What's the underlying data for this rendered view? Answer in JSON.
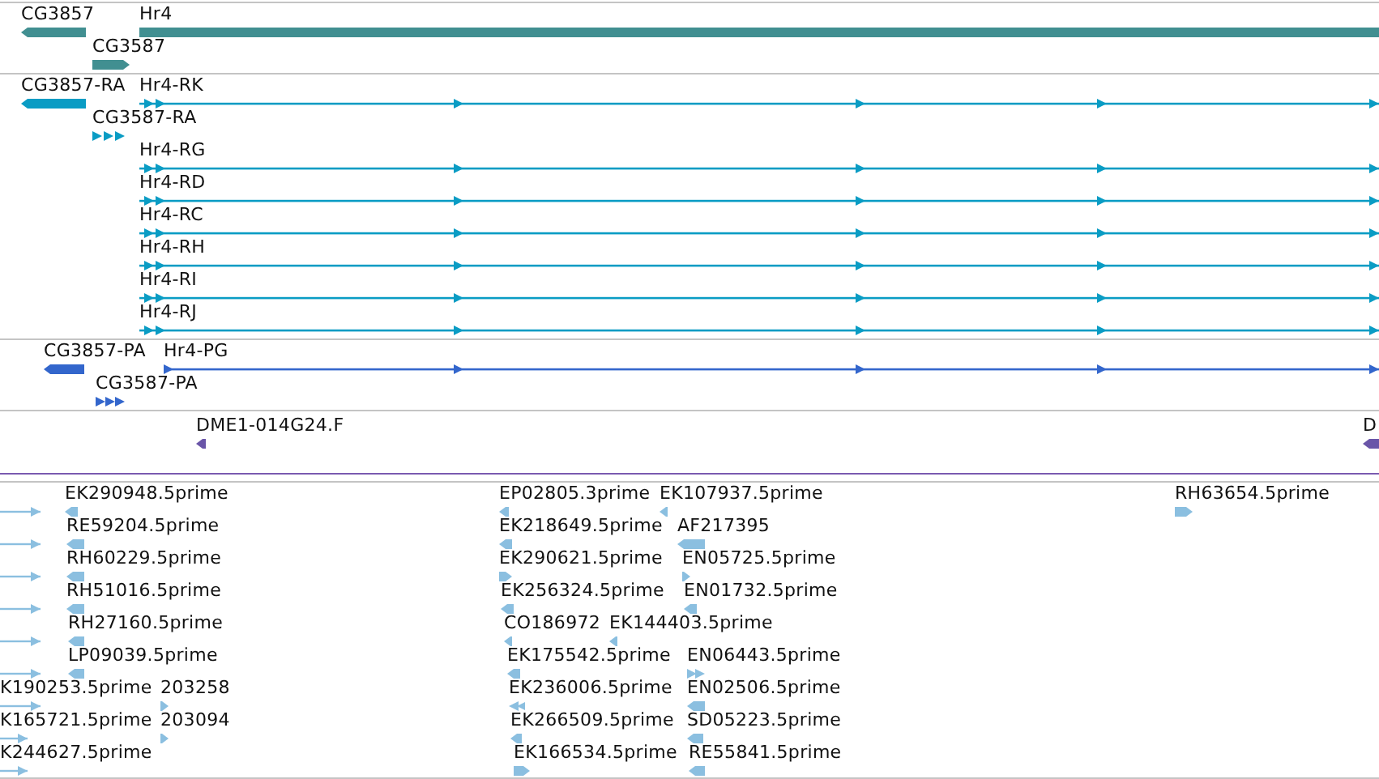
{
  "tracks": [
    {
      "color": "#418f91",
      "features": [
        {
          "label": "CG3857",
          "kind": "gene",
          "reverse": true
        },
        {
          "label": "Hr4",
          "kind": "gene"
        },
        {
          "label": "CG3587",
          "kind": "gene",
          "reverse": false
        }
      ]
    },
    {
      "color": "#0a9cc4",
      "features": [
        {
          "label": "CG3857-RA",
          "kind": "gene",
          "reverse": true
        },
        {
          "label": "Hr4-RK",
          "kind": "transcript",
          "reverse": false
        },
        {
          "label": "CG3587-RA",
          "kind": "exons",
          "reverse": false
        },
        {
          "label": "Hr4-RG",
          "kind": "transcript",
          "reverse": false
        },
        {
          "label": "Hr4-RD",
          "kind": "transcript",
          "reverse": false
        },
        {
          "label": "Hr4-RC",
          "kind": "transcript",
          "reverse": false
        },
        {
          "label": "Hr4-RH",
          "kind": "transcript",
          "reverse": false
        },
        {
          "label": "Hr4-RI",
          "kind": "transcript",
          "reverse": false
        },
        {
          "label": "Hr4-RJ",
          "kind": "transcript",
          "reverse": false
        }
      ]
    },
    {
      "color": "#3366cc",
      "features": [
        {
          "label": "CG3857-PA",
          "kind": "gene",
          "reverse": true
        },
        {
          "label": "Hr4-PG",
          "kind": "transcript",
          "reverse": false
        },
        {
          "label": "CG3587-PA",
          "kind": "exons",
          "reverse": false
        }
      ]
    },
    {
      "color": "#6a55a8",
      "features": [
        {
          "label": "DME1-014G24.F",
          "kind": "gene",
          "reverse": true
        },
        {
          "label": "D",
          "kind": "gene",
          "reverse": true
        }
      ]
    },
    {
      "color": "#8bbfe0",
      "features": [
        {
          "kind": "read",
          "reverse": false
        },
        {
          "kind": "read",
          "reverse": false
        },
        {
          "kind": "read",
          "reverse": false
        },
        {
          "kind": "read",
          "reverse": false
        },
        {
          "kind": "read",
          "reverse": false
        },
        {
          "kind": "read",
          "reverse": false
        },
        {
          "label": "EK290948.5prime",
          "kind": "gene",
          "reverse": true
        },
        {
          "label": "RE59204.5prime",
          "kind": "gene",
          "reverse": true
        },
        {
          "label": "RH60229.5prime",
          "kind": "gene",
          "reverse": true
        },
        {
          "label": "RH51016.5prime",
          "kind": "gene",
          "reverse": true
        },
        {
          "label": "RH27160.5prime",
          "kind": "gene",
          "reverse": true
        },
        {
          "label": "LP09039.5prime",
          "kind": "gene",
          "reverse": true
        },
        {
          "label": "K190253.5prime",
          "kind": "read",
          "reverse": false
        },
        {
          "label": "K165721.5prime",
          "kind": "read",
          "reverse": false
        },
        {
          "label": "K244627.5prime",
          "kind": "read",
          "reverse": false
        },
        {
          "label": "203258",
          "kind": "gene",
          "reverse": false
        },
        {
          "label": "203094",
          "kind": "gene",
          "reverse": false
        },
        {
          "label": "EP02805.3prime",
          "kind": "gene",
          "reverse": true
        },
        {
          "label": "EK107937.5prime",
          "kind": "gene",
          "reverse": true
        },
        {
          "label": "RH63654.5prime",
          "kind": "gene",
          "reverse": false
        },
        {
          "label": "EK218649.5prime",
          "kind": "gene",
          "reverse": true
        },
        {
          "label": "AF217395",
          "kind": "gene",
          "reverse": true
        },
        {
          "label": "EK290621.5prime",
          "kind": "gene",
          "reverse": false
        },
        {
          "label": "EN05725.5prime",
          "kind": "gene",
          "reverse": false
        },
        {
          "label": "EK256324.5prime",
          "kind": "gene",
          "reverse": true
        },
        {
          "label": "EN01732.5prime",
          "kind": "gene",
          "reverse": true
        },
        {
          "label": "CO186972",
          "kind": "gene",
          "reverse": true
        },
        {
          "label": "EK144403.5prime",
          "kind": "gene",
          "reverse": true
        },
        {
          "label": "EK175542.5prime",
          "kind": "gene",
          "reverse": true
        },
        {
          "label": "EN06443.5prime",
          "kind": "exons",
          "reverse": false
        },
        {
          "label": "EK236006.5prime",
          "kind": "exons",
          "reverse": true
        },
        {
          "label": "EN02506.5prime",
          "kind": "gene",
          "reverse": true
        },
        {
          "label": "EK266509.5prime",
          "kind": "gene",
          "reverse": true
        },
        {
          "label": "SD05223.5prime",
          "kind": "gene",
          "reverse": true
        },
        {
          "label": "EK166534.5prime",
          "kind": "gene",
          "reverse": false
        },
        {
          "label": "RE55841.5prime",
          "kind": "gene",
          "reverse": true
        }
      ]
    }
  ]
}
